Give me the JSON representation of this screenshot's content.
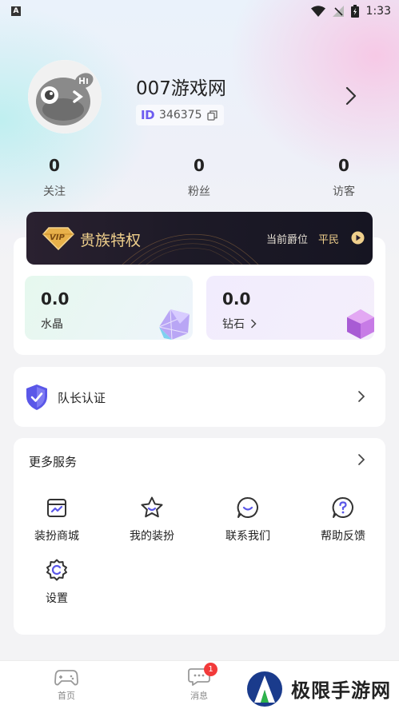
{
  "status_bar": {
    "app_indicator": "A",
    "time": "1:33"
  },
  "profile": {
    "username": "007游戏网",
    "id_label": "ID",
    "id_value": "346375"
  },
  "stats": [
    {
      "value": "0",
      "label": "关注"
    },
    {
      "value": "0",
      "label": "粉丝"
    },
    {
      "value": "0",
      "label": "访客"
    }
  ],
  "vip": {
    "badge": "VIP",
    "title": "贵族特权",
    "level_label": "当前爵位",
    "level_value": "平民"
  },
  "wallet": {
    "crystal": {
      "value": "0.0",
      "label": "水晶"
    },
    "diamond": {
      "value": "0.0",
      "label": "钻石"
    }
  },
  "captain": {
    "label": "队长认证"
  },
  "services": {
    "title": "更多服务",
    "items": [
      {
        "label": "装扮商城",
        "icon": "storefront-icon"
      },
      {
        "label": "我的装扮",
        "icon": "star-face-icon"
      },
      {
        "label": "联系我们",
        "icon": "chat-smile-icon"
      },
      {
        "label": "帮助反馈",
        "icon": "help-icon"
      },
      {
        "label": "设置",
        "icon": "settings-icon"
      }
    ]
  },
  "tabbar": {
    "items": [
      {
        "label": "首页",
        "icon": "gamepad-icon"
      },
      {
        "label": "消息",
        "icon": "message-icon"
      }
    ],
    "message_badge": "1"
  },
  "watermark": {
    "text": "极限手游网"
  },
  "colors": {
    "accent_purple": "#6d5cf0",
    "gold": "#f0d08c",
    "badge_red": "#f23a3a",
    "vip_bg": "#1d1a27"
  }
}
